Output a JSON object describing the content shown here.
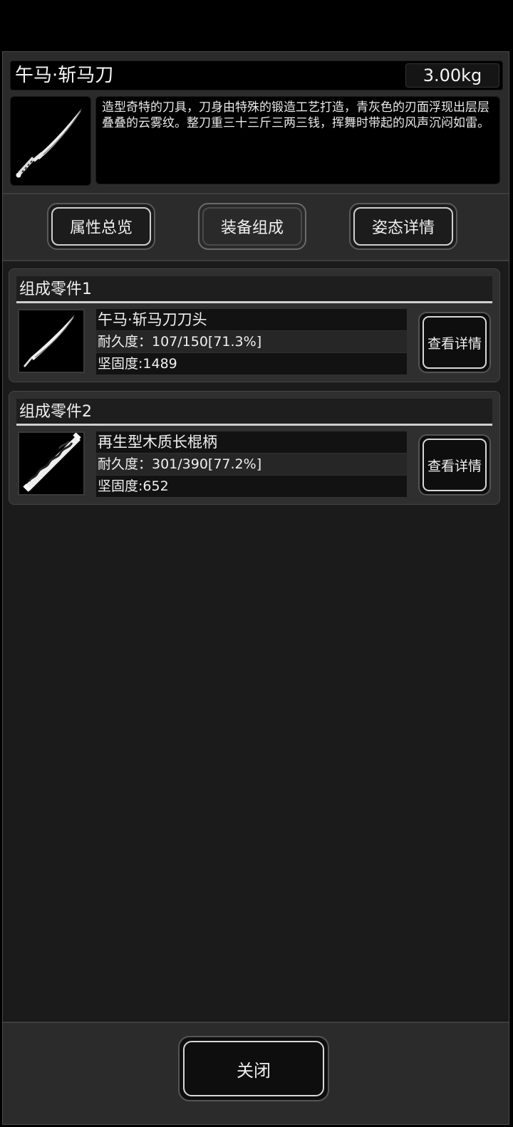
{
  "item": {
    "name": "午马·斩马刀",
    "weight": "3.00kg",
    "description": "造型奇特的刀具，刀身由特殊的锻造工艺打造，青灰色的刃面浮现出层层叠叠的云雾纹。整刀重三十三斤三两三钱，挥舞时带起的风声沉闷如雷。",
    "icon": "saber-icon"
  },
  "tabs": [
    {
      "label": "属性总览",
      "active": false
    },
    {
      "label": "装备组成",
      "active": true
    },
    {
      "label": "姿态详情",
      "active": false
    }
  ],
  "parts": [
    {
      "header": "组成零件1",
      "name": "午马·斩马刀刀头",
      "durability": "耐久度：107/150[71.3%]",
      "hardness": "坚固度:1489",
      "detail_label": "查看详情",
      "icon": "blade-icon"
    },
    {
      "header": "组成零件2",
      "name": "再生型木质长棍柄",
      "durability": "耐久度：301/390[77.2%]",
      "hardness": "坚固度:652",
      "detail_label": "查看详情",
      "icon": "staff-handle-icon"
    }
  ],
  "footer": {
    "close_label": "关闭"
  }
}
